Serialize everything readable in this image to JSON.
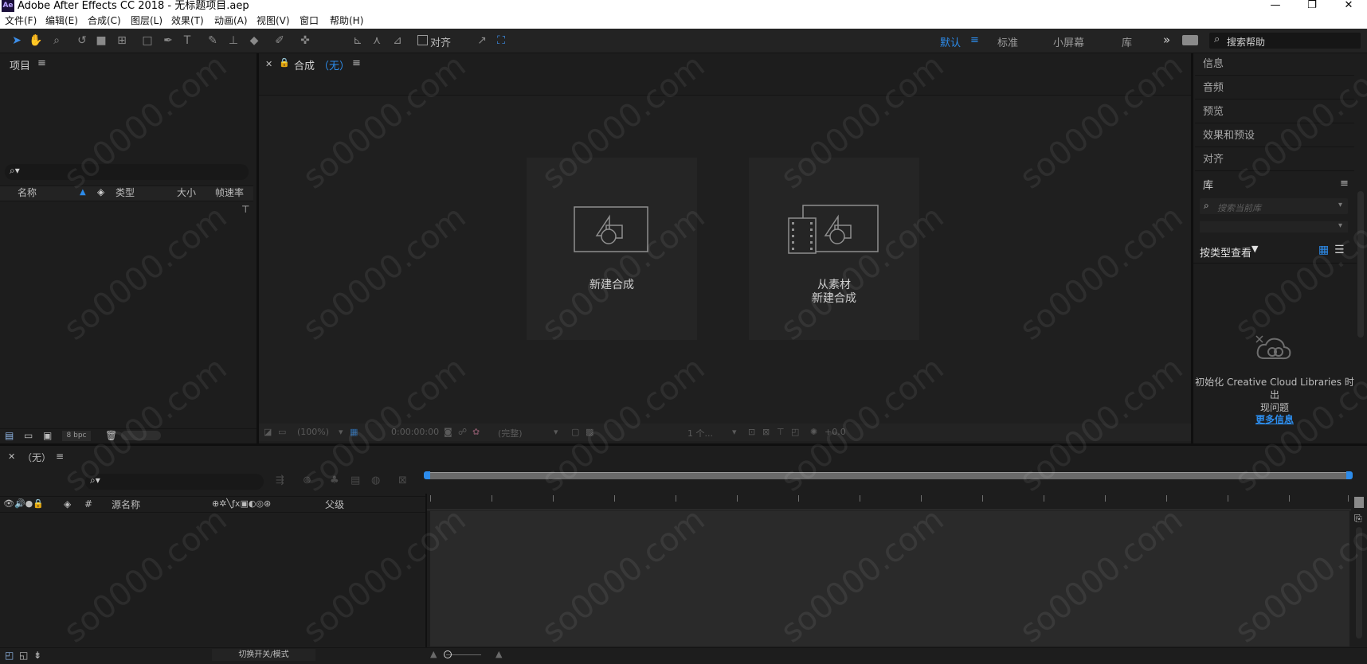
{
  "window": {
    "app_logo": "Ae",
    "title": "Adobe After Effects CC 2018 - 无标题项目.aep",
    "minimize_icon": "—",
    "maximize_icon": "❐",
    "close_icon": "✕"
  },
  "menu": [
    "文件(F)",
    "编辑(E)",
    "合成(C)",
    "图层(L)",
    "效果(T)",
    "动画(A)",
    "视图(V)",
    "窗口",
    "帮助(H)"
  ],
  "toolbar": {
    "snap_label": "对齐",
    "workspaces": [
      "默认",
      "标准",
      "小屏幕",
      "库"
    ],
    "active_workspace": "默认",
    "more_icon": "»",
    "help_search_placeholder": "搜索帮助",
    "accent_color": "#2d8ceb"
  },
  "project_panel": {
    "title": "项目",
    "columns": [
      "名称",
      "类型",
      "大小",
      "帧速率"
    ],
    "bpc": "8 bpc"
  },
  "composition_panel": {
    "tab_label": "合成",
    "comp_name": "（无）",
    "new_comp_label": "新建合成",
    "from_footage_line1": "从素材",
    "from_footage_line2": "新建合成",
    "zoom": "(100%)",
    "timecode": "0:00:00:00",
    "resolution": "(完整)",
    "views": "1 个...",
    "exposure": "+0.0"
  },
  "right_panels": {
    "items": [
      "信息",
      "音频",
      "预览",
      "效果和预设",
      "对齐"
    ],
    "library": {
      "title": "库",
      "search_placeholder": "搜索当前库",
      "view_by_type": "按类型查看",
      "error_line1": "初始化 Creative Cloud Libraries 时出",
      "error_line2": "现问题",
      "more_info": "更多信息"
    }
  },
  "timeline": {
    "tab_label": "（无）",
    "column_num": "#",
    "column_source": "源名称",
    "column_parent": "父级",
    "toggle_label": "切换开关/模式"
  }
}
